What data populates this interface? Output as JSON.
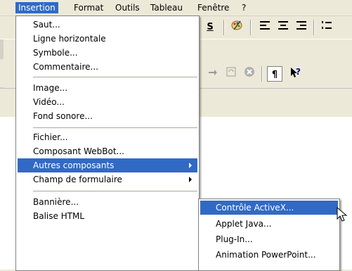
{
  "menubar": {
    "items": [
      "Insertion",
      "Format",
      "Outils",
      "Tableau",
      "Fenêtre",
      "?"
    ]
  },
  "toolbar": {
    "underline_label": "S",
    "pilcrow": "¶",
    "help_cursor": "?"
  },
  "insertion_menu": {
    "group1": [
      "Saut...",
      "Ligne horizontale",
      "Symbole...",
      "Commentaire..."
    ],
    "group2": [
      "Image...",
      "Vidéo...",
      "Fond sonore..."
    ],
    "group3": [
      "Fichier...",
      "Composant WebBot...",
      "Autres composants",
      "Champ de formulaire"
    ],
    "group4": [
      "Bannière...",
      "Balise HTML"
    ]
  },
  "autres_composants_submenu": {
    "items": [
      "Contrôle ActiveX...",
      "Applet Java...",
      "Plug-In...",
      "Animation PowerPoint..."
    ]
  },
  "colors": {
    "highlight": "#316ac5",
    "menu_bg": "#ffffff",
    "chrome": "#ece9d8"
  }
}
